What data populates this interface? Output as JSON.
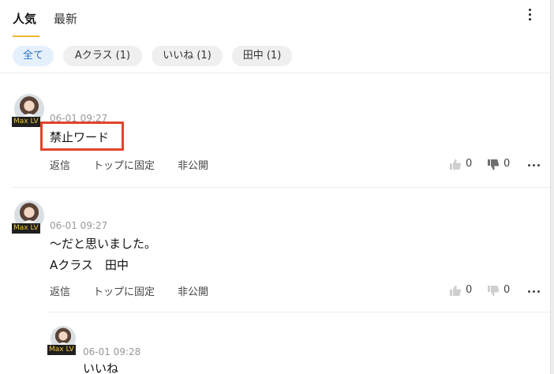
{
  "tabs": [
    {
      "label": "人気",
      "active": true
    },
    {
      "label": "最新",
      "active": false
    }
  ],
  "filters": [
    {
      "label": "全て",
      "active": true
    },
    {
      "label": "Aクラス (1)",
      "active": false
    },
    {
      "label": "いいね (1)",
      "active": false
    },
    {
      "label": "田中 (1)",
      "active": false
    }
  ],
  "comments": [
    {
      "level": "Max LV",
      "time": "06-01 09:27",
      "text_lines": [
        "禁止ワード"
      ],
      "flagged": true,
      "actions": {
        "reply": "返信",
        "pin": "トップに固定",
        "private": "非公開"
      },
      "likes": "0",
      "dislikes": "0"
    },
    {
      "level": "Max LV",
      "time": "06-01 09:27",
      "text_lines": [
        "〜だと思いました。",
        "Aクラス　田中"
      ],
      "flagged": false,
      "actions": {
        "reply": "返信",
        "pin": "トップに固定",
        "private": "非公開"
      },
      "likes": "0",
      "dislikes": "0"
    }
  ],
  "reply": {
    "level": "Max LV",
    "time": "06-01 09:28",
    "text": "いいね"
  },
  "colors": {
    "accent": "#f2b72b",
    "chip_active_text": "#2b73c5",
    "flag_border": "#e2432c",
    "level_text": "#f3c33b"
  }
}
